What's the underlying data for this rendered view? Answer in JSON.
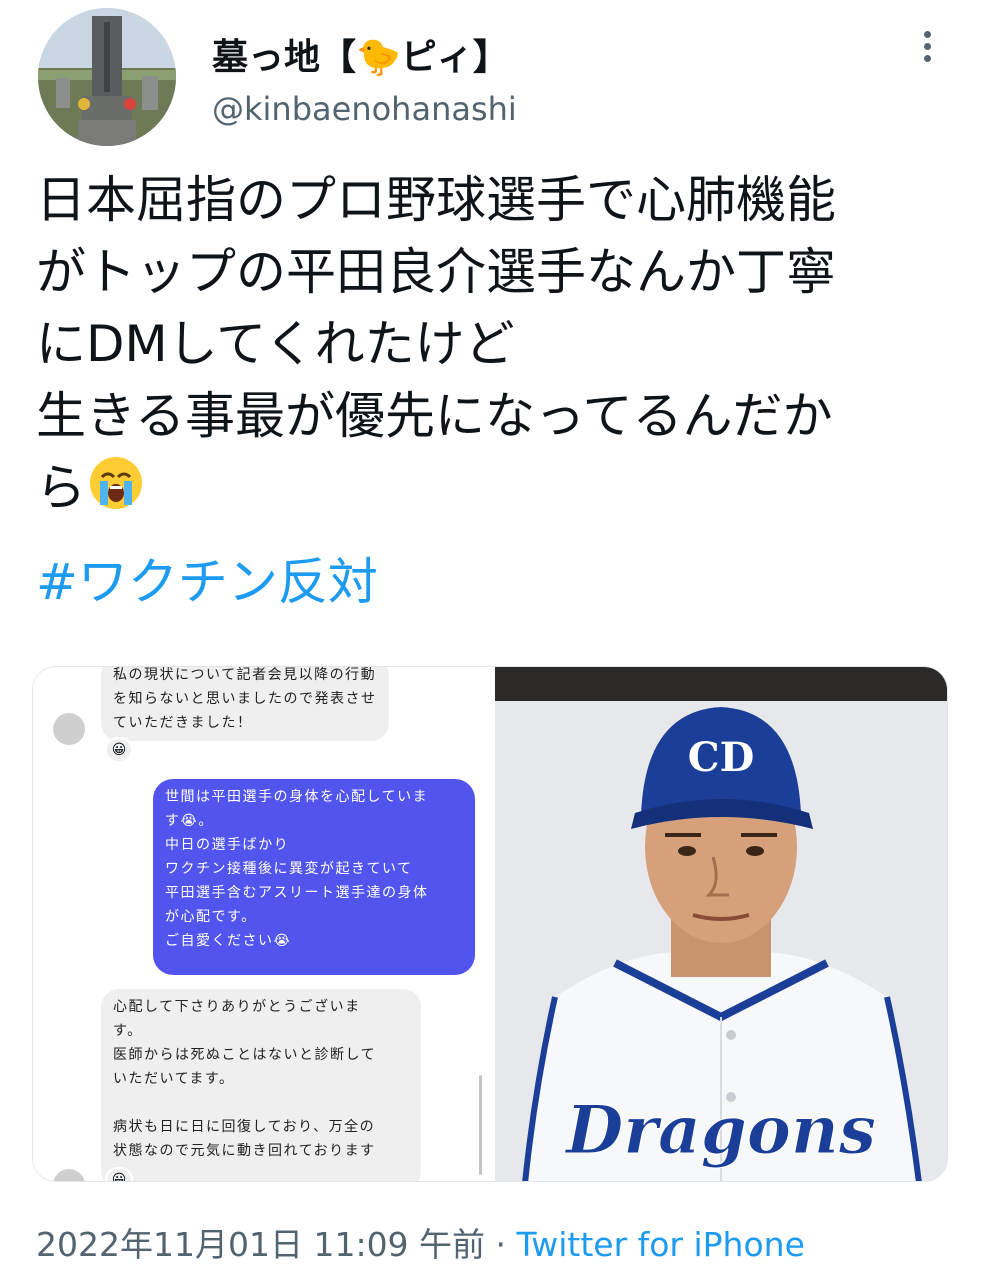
{
  "author": {
    "display_name": "墓っ地【🐤ピィ】",
    "handle": "@kinbaenohanashi"
  },
  "tweet": {
    "lines": [
      "日本屈指のプロ野球選手で心肺機能",
      "がトップの平田良介選手なんか丁寧",
      "にDMしてくれたけど",
      "生きる事最が優先になってるんだか",
      "ら"
    ],
    "emoji": "😭",
    "hashtag": "#ワクチン反対"
  },
  "dm": {
    "msg1": "私の現状について記者会見以降の行動\nを知らないと思いましたので発表させ\nていただきました！",
    "reaction1": "😀",
    "msg2": "世間は平田選手の身体を心配していま\nす😭。\n中日の選手ばかり\nワクチン接種後に異変が起きていて\n平田選手含むアスリート選手達の身体\nが心配です。\nご自愛ください😭",
    "msg3": "心配して下さりありがとうございま\nす。\n医師からは死ぬことはないと診断して\nいただいてます。\n\n病状も日に日に回復しており、万全の\n状態なので元気に動き回れております",
    "reaction3": "😀"
  },
  "photo": {
    "cap_logo": "CD",
    "jersey_text": "Dragons"
  },
  "footer": {
    "timestamp": "2022年11月01日 11:09 午前",
    "separator": " · ",
    "source": "Twitter for iPhone"
  },
  "colors": {
    "link": "#1d9bf0",
    "dm_outgoing": "#5155ee",
    "dm_incoming": "#efefef",
    "team_blue": "#1b3f98"
  }
}
